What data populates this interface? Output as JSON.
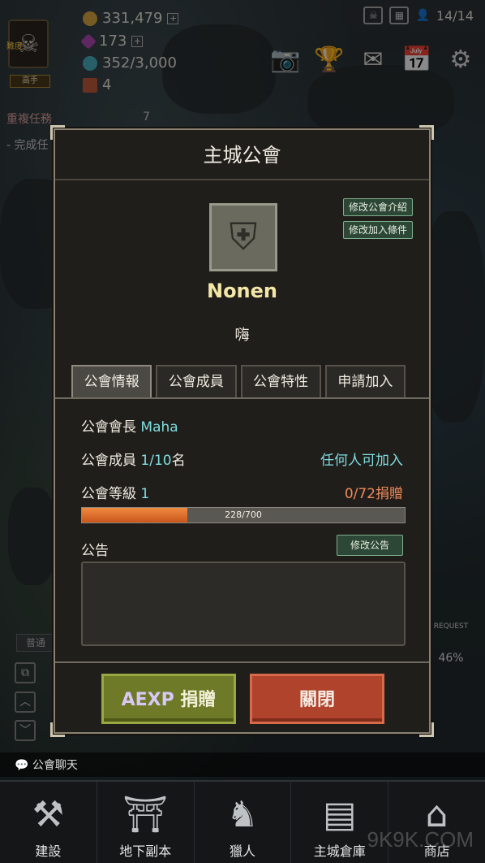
{
  "hud": {
    "difficulty_tag": "難度",
    "difficulty_level": "高手",
    "gold": "331,479",
    "gems": "173",
    "energy": "352/3,000",
    "tickets": "4",
    "party_count": "14/14",
    "quest_repeat": "重複任務",
    "quest_repeat_count": "7",
    "quest_complete": "- 完成任"
  },
  "dialog": {
    "title": "主城公會",
    "edit_intro_label": "修改公會介紹",
    "edit_join_label": "修改加入條件",
    "guild_name": "Nonen",
    "guild_desc": "嗨",
    "tabs": [
      {
        "label": "公會情報",
        "active": true
      },
      {
        "label": "公會成員",
        "active": false
      },
      {
        "label": "公會特性",
        "active": false
      },
      {
        "label": "申請加入",
        "active": false
      }
    ],
    "leader_label": "公會會長",
    "leader_name": "Maha",
    "members_label": "公會成員",
    "members_value": "1/10",
    "members_unit": "名",
    "join_policy": "任何人可加入",
    "level_label": "公會等級",
    "level_value": "1",
    "donation_value": "0/72",
    "donation_unit": "捐贈",
    "xp_text": "228/700",
    "xp_fraction": 0.3257,
    "notice_label": "公告",
    "edit_notice_label": "修改公告",
    "aexp_label": "AEXP",
    "donate_label": "捐贈",
    "close_label": "關閉"
  },
  "chat": {
    "tab_label": "普通",
    "bar_label": "公會聊天"
  },
  "side": {
    "request_label": "REQUEST",
    "request_pct": "46%"
  },
  "nav": [
    {
      "label": "建設",
      "icon": "build-icon"
    },
    {
      "label": "地下副本",
      "icon": "dungeon-icon"
    },
    {
      "label": "獵人",
      "icon": "hunter-icon"
    },
    {
      "label": "主城倉庫",
      "icon": "warehouse-icon"
    },
    {
      "label": "商店",
      "icon": "shop-icon"
    }
  ],
  "watermark": "9K9K.COM",
  "colors": {
    "accent_cyan": "#7fdde0",
    "accent_orange": "#f08a5a",
    "guild_name": "#f4e7a6",
    "aexp_button": "#6e7a28",
    "close_button": "#b0432c"
  }
}
